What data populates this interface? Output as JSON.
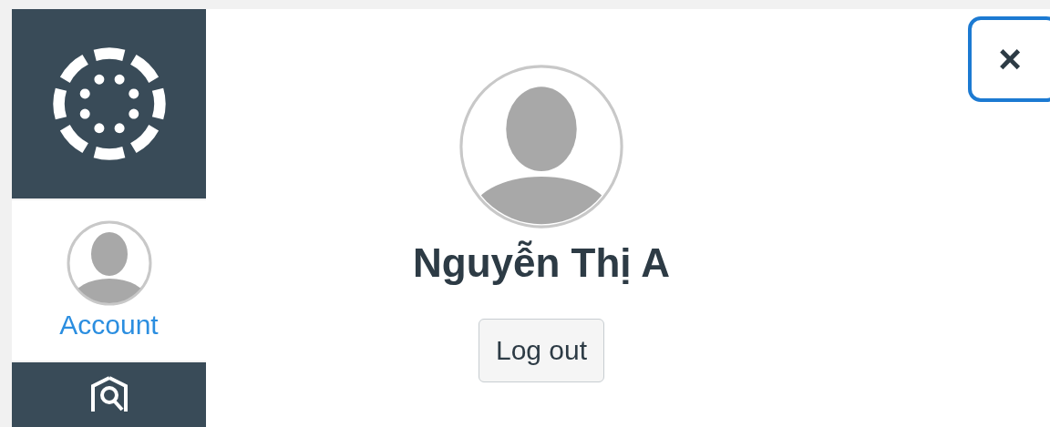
{
  "nav": [
    {
      "kind": "logo",
      "selected": false
    },
    {
      "kind": "account",
      "label": "Account",
      "selected": true
    },
    {
      "kind": "admin",
      "selected": false
    }
  ],
  "tray": {
    "close": "×",
    "name": "Nguyễn Thị A",
    "logout": "Log out"
  }
}
